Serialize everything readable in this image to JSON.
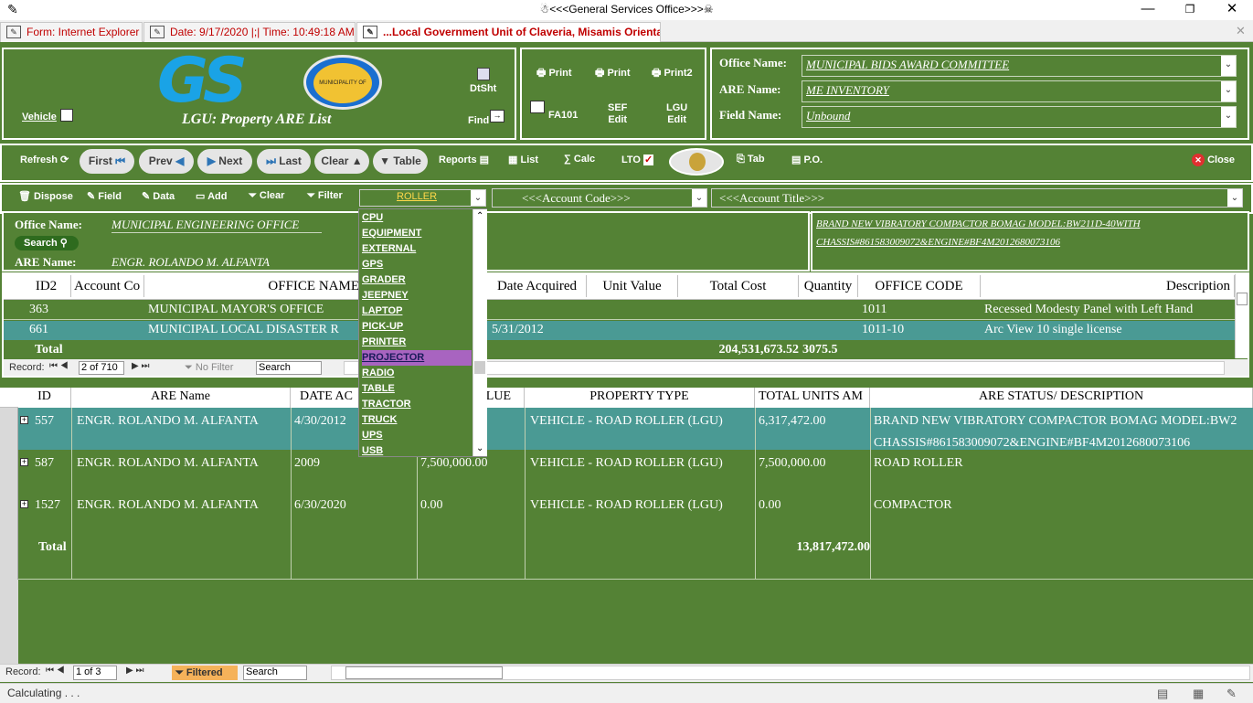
{
  "window": {
    "title": "☃<<<General Services Office>>>☠"
  },
  "tabs": [
    {
      "label": "Form: Internet Explorer"
    },
    {
      "label": "Date: 9/17/2020 |;| Time: 10:49:18 AM"
    },
    {
      "label": "...Local Government Unit of Claveria, Misamis Oriental ..."
    }
  ],
  "header": {
    "logo_text": "GS",
    "seal_text": "MUNICIPALITY OF CLAVERIA",
    "subtitle": "LGU:  Property ARE List",
    "vehicle_label": "Vehicle",
    "dtsht_label": "DtSht",
    "find_label": "Find",
    "print_buttons": [
      "Print",
      "Print",
      "Print2"
    ],
    "fa101_label": "FA101",
    "sef_edit_label": "SEF\nEdit",
    "lgu_edit_label": "LGU\nEdit",
    "office_name_label": "Office Name:",
    "office_name_value": "MUNICIPAL BIDS AWARD COMMITTEE",
    "are_name_label": "ARE Name:",
    "are_name_value": "ME INVENTORY",
    "field_name_label": "Field Name:",
    "field_name_value": "Unbound"
  },
  "nav": {
    "refresh": "Refresh",
    "first": "First",
    "prev": "Prev",
    "next": "Next",
    "last": "Last",
    "clear": "Clear",
    "table": "Table",
    "reports": "Reports",
    "list": "List",
    "calc": "Calc",
    "lto": "LTO",
    "tab": "Tab",
    "po": "P.O.",
    "close": "Close"
  },
  "filterbar": {
    "dispose": "Dispose",
    "field": "Field",
    "data": "Data",
    "add": "Add",
    "clear": "Clear",
    "filter": "Filter",
    "combo_value": "ROLLER",
    "account_code": "<<<Account Code>>>",
    "account_title": "<<<Account Title>>>"
  },
  "dropdown_items": [
    "CPU",
    "EQUIPMENT",
    "EXTERNAL",
    "GPS",
    "GRADER",
    "JEEPNEY",
    "LAPTOP",
    "PICK-UP",
    "PRINTER",
    "PROJECTOR",
    "RADIO",
    "TABLE",
    "TRACTOR",
    "TRUCK",
    "UPS",
    "USB"
  ],
  "dropdown_selected": "PROJECTOR",
  "info": {
    "office_name_label": "Office Name:",
    "office_name_value": "MUNICIPAL ENGINEERING OFFICE",
    "search_label": "Search",
    "are_name_label": "ARE Name:",
    "are_name_value": "ENGR. ROLANDO M. ALFANTA",
    "description": "BRAND NEW VIBRATORY COMPACTOR BOMAG MODEL:BW211D-40WITH CHASSIS#861583009072&ENGINE#BF4M2012680073106"
  },
  "grid1": {
    "columns": [
      "ID2",
      "Account Co",
      "OFFICE NAME",
      "Date Acquired",
      "Unit Value",
      "Total Cost",
      "Quantity",
      "OFFICE CODE",
      "Description"
    ],
    "rows": [
      [
        "363",
        "",
        "MUNICIPAL MAYOR'S OFFICE",
        "",
        "",
        "",
        "",
        "1011",
        "Recessed Modesty Panel with Left Hand"
      ],
      [
        "661",
        "",
        "MUNICIPAL LOCAL DISASTER R",
        "5/31/2012",
        "",
        "",
        "",
        "1011-10",
        "Arc View 10 single license"
      ]
    ],
    "total_label": "Total",
    "total_cost": "204,531,673.52",
    "total_quantity": "3075.5",
    "record_label": "Record:",
    "record_value": "2 of 710",
    "filter_label": "No Filter",
    "search_value": "Search"
  },
  "grid2": {
    "columns": [
      "ID",
      "ARE Name",
      "DATE AC",
      "LUE",
      "PROPERTY TYPE",
      "TOTAL UNITS AM",
      "ARE STATUS/ DESCRIPTION"
    ],
    "rows": [
      [
        "557",
        "ENGR. ROLANDO M. ALFANTA",
        "4/30/2012",
        "",
        "VEHICLE - ROAD ROLLER (LGU)",
        "6,317,472.00",
        "BRAND NEW VIBRATORY COMPACTOR BOMAG MODEL:BW2",
        "CHASSIS#861583009072&ENGINE#BF4M2012680073106"
      ],
      [
        "587",
        "ENGR. ROLANDO M. ALFANTA",
        "2009",
        "7,500,000.00",
        "VEHICLE - ROAD ROLLER (LGU)",
        "7,500,000.00",
        "ROAD ROLLER",
        ""
      ],
      [
        "1527",
        "ENGR. ROLANDO M. ALFANTA",
        "6/30/2020",
        "0.00",
        "VEHICLE - ROAD ROLLER (LGU)",
        "0.00",
        "COMPACTOR",
        ""
      ]
    ],
    "total_label": "Total",
    "total_units": "13,817,472.00",
    "record_label": "Record:",
    "record_value": "1 of 3",
    "filter_label": "Filtered",
    "search_value": "Search"
  },
  "status": {
    "text": "Calculating . . ."
  },
  "colors": {
    "green": "#548235",
    "selected_row": "#4a9a94",
    "dropdown_sel": "#a864c0"
  }
}
